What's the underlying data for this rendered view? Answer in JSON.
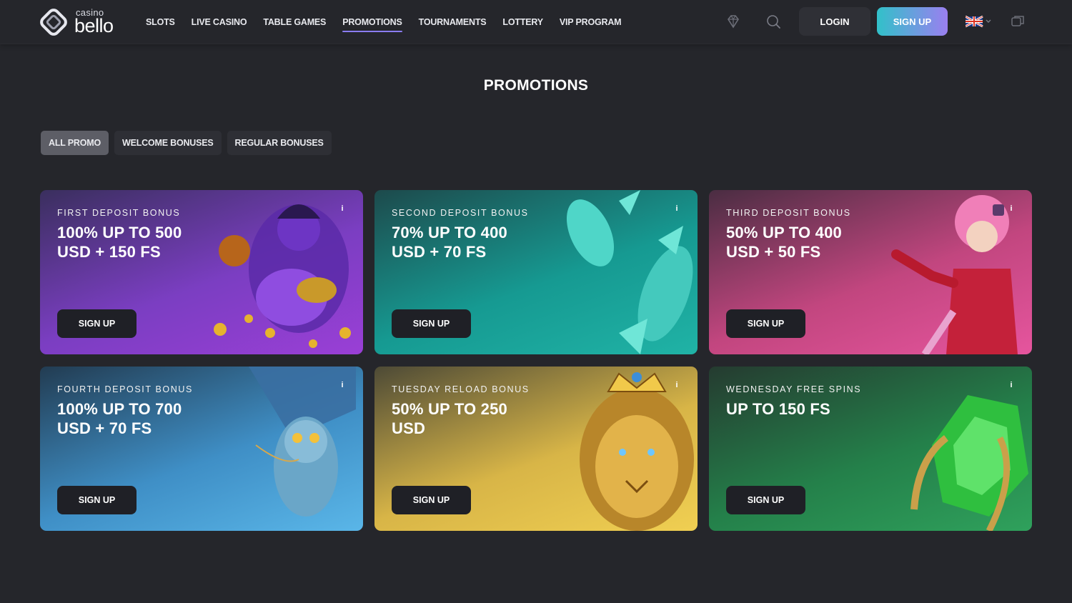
{
  "header": {
    "logo_small": "casino",
    "logo_big": "bello",
    "nav": [
      {
        "label": "SLOTS",
        "active": false
      },
      {
        "label": "LIVE CASINO",
        "active": false
      },
      {
        "label": "TABLE GAMES",
        "active": false
      },
      {
        "label": "PROMOTIONS",
        "active": true
      },
      {
        "label": "TOURNAMENTS",
        "active": false
      },
      {
        "label": "LOTTERY",
        "active": false
      },
      {
        "label": "VIP PROGRAM",
        "active": false
      }
    ],
    "login_label": "LOGIN",
    "signup_label": "SIGN UP",
    "icons": [
      "diamond-icon",
      "search-icon",
      "uk-flag-icon",
      "chat-icon"
    ]
  },
  "page": {
    "title": "PROMOTIONS"
  },
  "filters": [
    {
      "label": "ALL PROMO",
      "active": true
    },
    {
      "label": "WELCOME BONUSES",
      "active": false
    },
    {
      "label": "REGULAR BONUSES",
      "active": false
    }
  ],
  "promos": [
    {
      "subtitle": "FIRST DEPOSIT BONUS",
      "title_line1": "100% UP TO 500",
      "title_line2": "USD + 150 FS",
      "button": "SIGN UP",
      "gradient": [
        "#3a2f5e",
        "#9a3fd6"
      ],
      "art": "genie-art"
    },
    {
      "subtitle": "SECOND DEPOSIT BONUS",
      "title_line1": "70% UP TO 400",
      "title_line2": "USD + 70 FS",
      "button": "SIGN UP",
      "gradient": [
        "#1d4a4c",
        "#20b3a6"
      ],
      "art": "koi-fish-art"
    },
    {
      "subtitle": "THIRD DEPOSIT BONUS",
      "title_line1": "50% UP TO 400",
      "title_line2": "USD + 50 FS",
      "button": "SIGN UP",
      "gradient": [
        "#4a2d42",
        "#e6559e"
      ],
      "art": "harlequin-art"
    },
    {
      "subtitle": "FOURTH DEPOSIT BONUS",
      "title_line1": "100% UP TO 700",
      "title_line2": "USD + 70 FS",
      "button": "SIGN UP",
      "gradient": [
        "#223c52",
        "#5ab6e8"
      ],
      "art": "owl-art"
    },
    {
      "subtitle": "TUESDAY RELOAD BONUS",
      "title_line1": "50% UP TO 250",
      "title_line2": "USD",
      "button": "SIGN UP",
      "gradient": [
        "#4d4a36",
        "#f0cf52"
      ],
      "art": "lion-art"
    },
    {
      "subtitle": "WEDNESDAY FREE SPINS",
      "title_line1": "UP TO 150 FS",
      "title_line2": "",
      "button": "SIGN UP",
      "gradient": [
        "#253b30",
        "#2fa15c"
      ],
      "art": "emerald-art"
    }
  ]
}
